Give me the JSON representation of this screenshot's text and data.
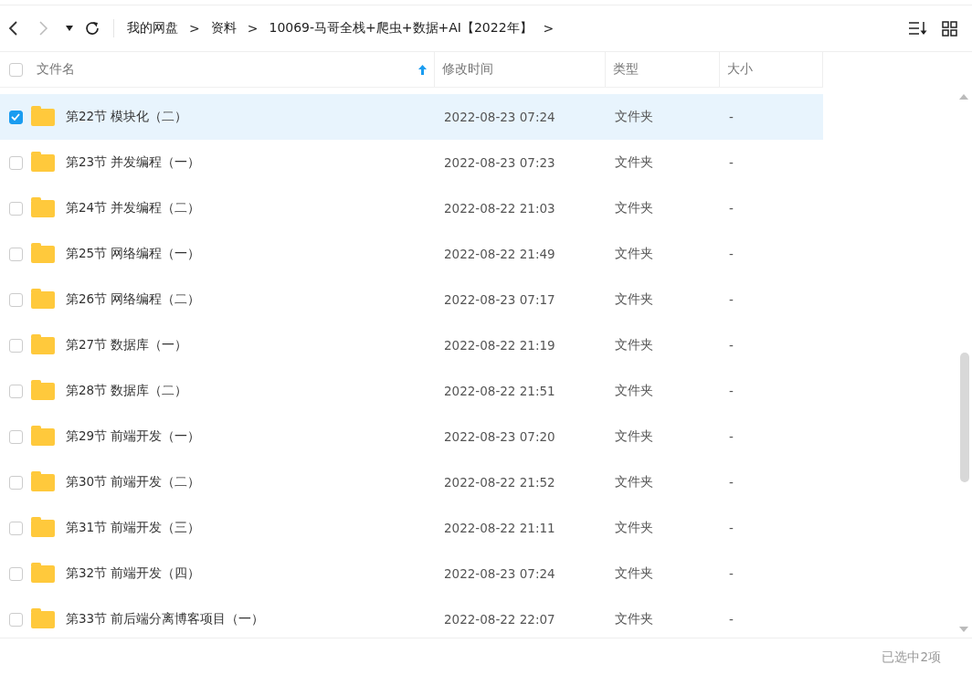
{
  "toolbar": {
    "breadcrumb": [
      "我的网盘",
      "资料",
      "10069-马哥全栈+爬虫+数据+AI【2022年】"
    ],
    "separator": ">"
  },
  "table": {
    "select_all": {
      "checked": false
    },
    "columns": [
      {
        "label": "文件名",
        "sorted": true
      },
      {
        "label": "修改时间",
        "sorted": false
      },
      {
        "label": "类型",
        "sorted": false
      },
      {
        "label": "大小",
        "sorted": false
      }
    ],
    "rows": [
      {
        "name": "第22节 模块化（二）",
        "modified": "2022-08-23 07:24",
        "type": "文件夹",
        "size": "-",
        "selected": true
      },
      {
        "name": "第23节 并发编程（一）",
        "modified": "2022-08-23 07:23",
        "type": "文件夹",
        "size": "-",
        "selected": false
      },
      {
        "name": "第24节 并发编程（二）",
        "modified": "2022-08-22 21:03",
        "type": "文件夹",
        "size": "-",
        "selected": false
      },
      {
        "name": "第25节 网络编程（一）",
        "modified": "2022-08-22 21:49",
        "type": "文件夹",
        "size": "-",
        "selected": false
      },
      {
        "name": "第26节 网络编程（二）",
        "modified": "2022-08-23 07:17",
        "type": "文件夹",
        "size": "-",
        "selected": false
      },
      {
        "name": "第27节 数据库（一）",
        "modified": "2022-08-22 21:19",
        "type": "文件夹",
        "size": "-",
        "selected": false
      },
      {
        "name": "第28节 数据库（二）",
        "modified": "2022-08-22 21:51",
        "type": "文件夹",
        "size": "-",
        "selected": false
      },
      {
        "name": "第29节 前端开发（一）",
        "modified": "2022-08-23 07:20",
        "type": "文件夹",
        "size": "-",
        "selected": false
      },
      {
        "name": "第30节 前端开发（二）",
        "modified": "2022-08-22 21:52",
        "type": "文件夹",
        "size": "-",
        "selected": false
      },
      {
        "name": "第31节 前端开发（三）",
        "modified": "2022-08-22 21:11",
        "type": "文件夹",
        "size": "-",
        "selected": false
      },
      {
        "name": "第32节 前端开发（四）",
        "modified": "2022-08-23 07:24",
        "type": "文件夹",
        "size": "-",
        "selected": false
      },
      {
        "name": "第33节 前后端分离博客项目（一）",
        "modified": "2022-08-22 22:07",
        "type": "文件夹",
        "size": "-",
        "selected": false
      }
    ]
  },
  "status_bar": {
    "text": "已选中2项"
  }
}
